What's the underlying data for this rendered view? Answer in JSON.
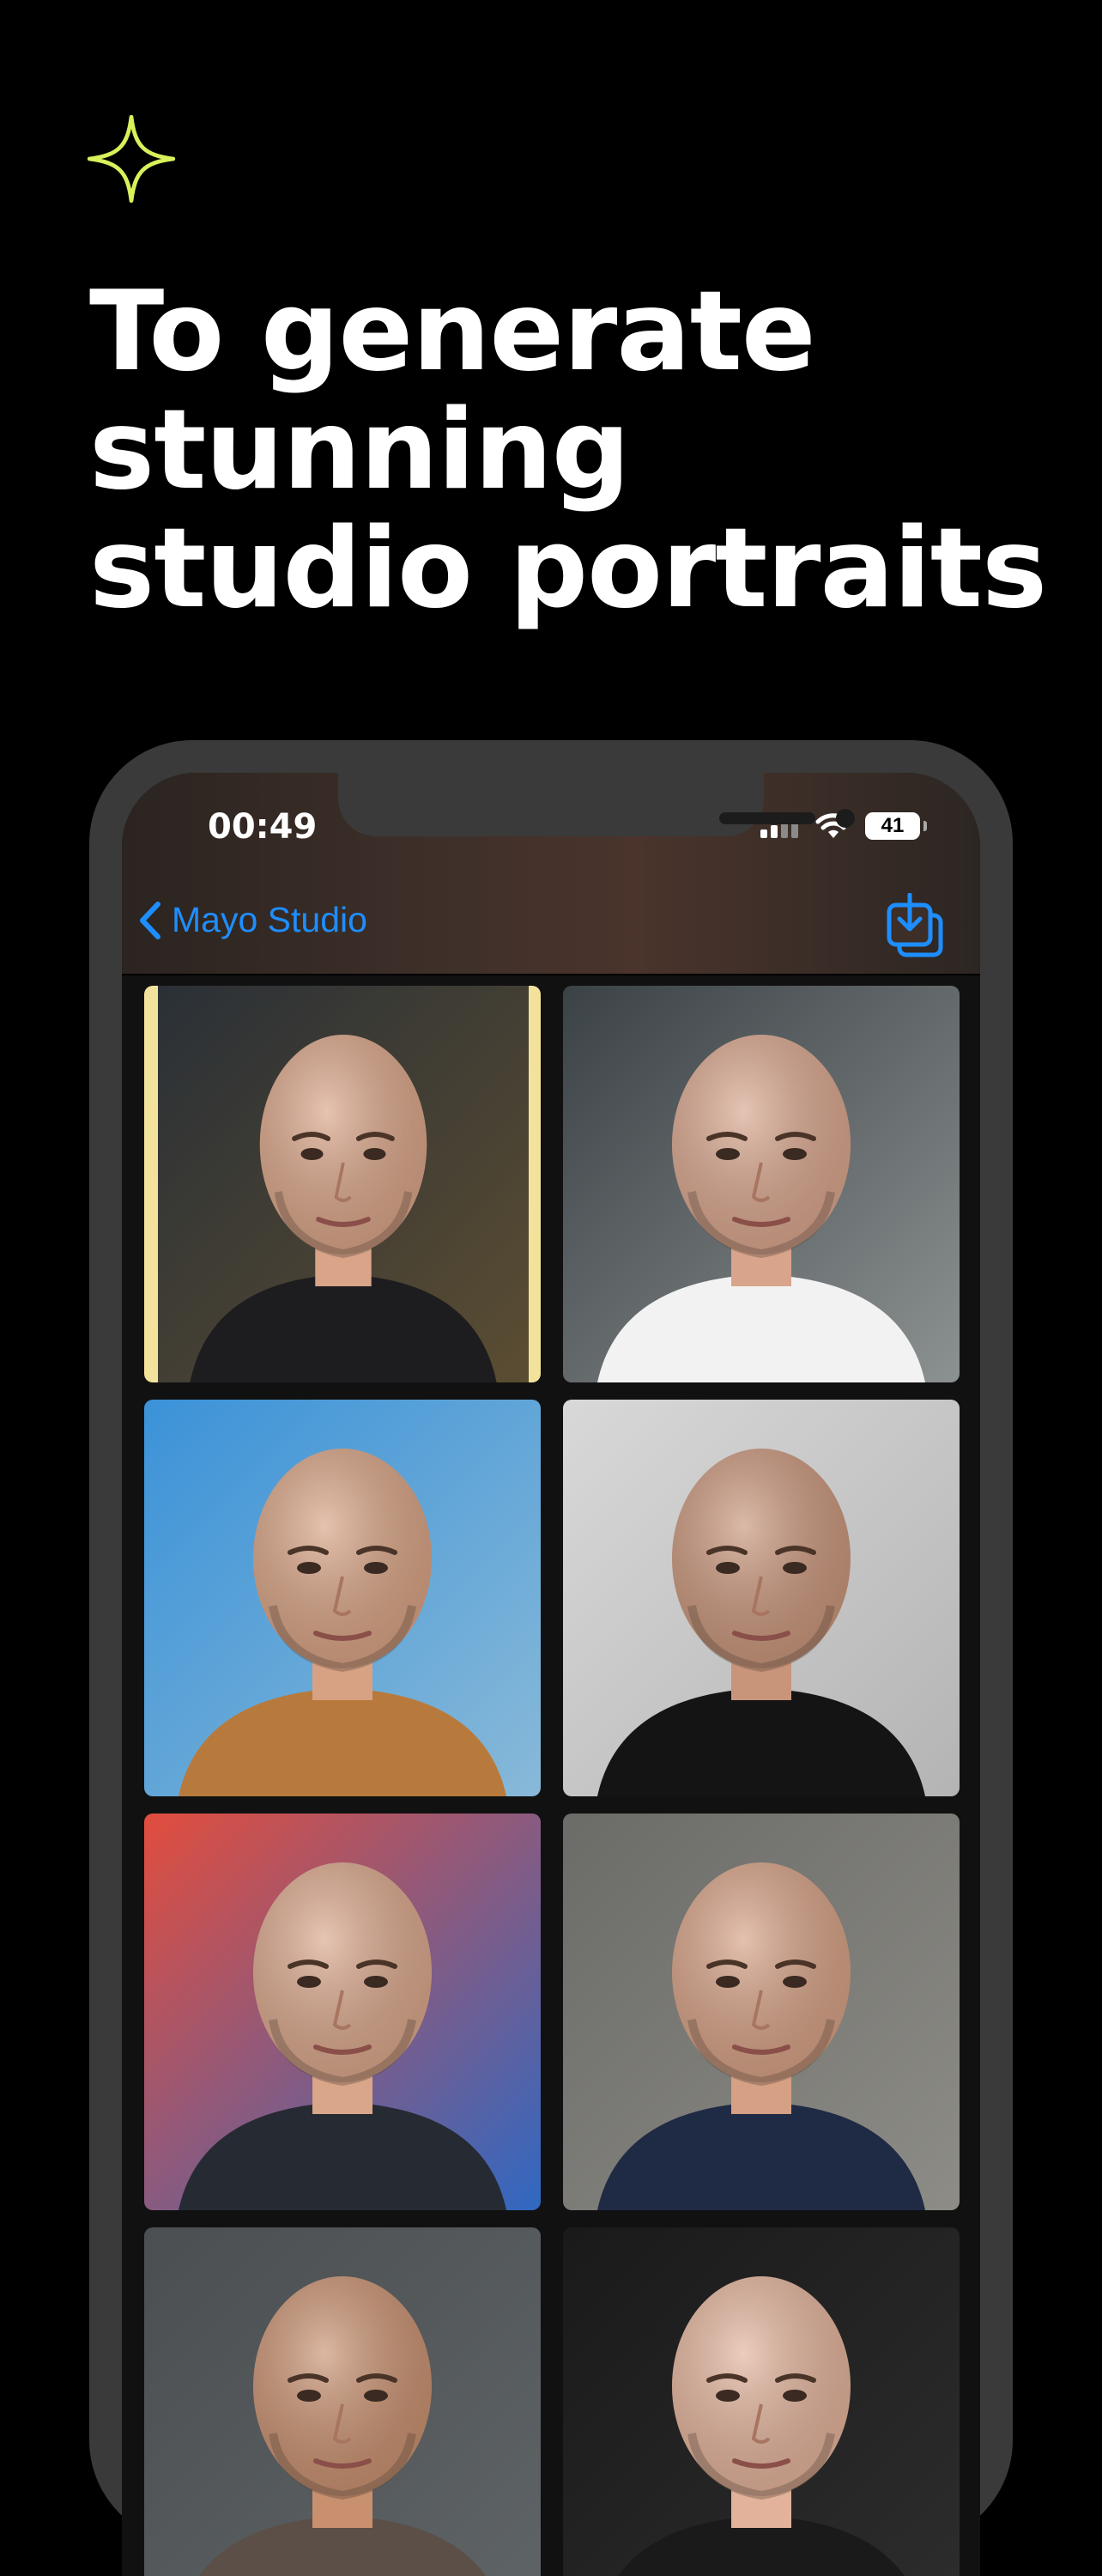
{
  "headline": {
    "lines": [
      "To generate",
      "stunning",
      "studio portraits"
    ]
  },
  "colors": {
    "accent": "#d8f05a",
    "link": "#1e8eff",
    "background": "#000000",
    "selected_frame": "#f3e29b"
  },
  "status_bar": {
    "time": "00:49",
    "battery": "41",
    "icons": [
      "cellular-signal-icon",
      "wifi-icon",
      "battery-icon"
    ]
  },
  "nav": {
    "back_label": "Mayo Studio",
    "back_icon": "chevron-left-icon",
    "action_icon": "download-icon"
  },
  "gallery": {
    "selected_index": 0,
    "photos": [
      {
        "bg": [
          "#2a3036",
          "#5b4d32"
        ],
        "clothing": "#1d1d1f",
        "skin": "#d9a487"
      },
      {
        "bg": [
          "#3b4246",
          "#8c9191"
        ],
        "clothing": "#f2f2f2",
        "skin": "#d8a58c"
      },
      {
        "bg": [
          "#3b92d8",
          "#88b9d8"
        ],
        "clothing": "#b87a3c",
        "skin": "#d7a283"
      },
      {
        "bg": [
          "#d8d8d8",
          "#b4b4b4"
        ],
        "clothing": "#141414",
        "skin": "#c8957a"
      },
      {
        "bg": [
          "#e24d3d",
          "#3068c2"
        ],
        "clothing": "#262a33",
        "skin": "#d9a68a"
      },
      {
        "bg": [
          "#6b6b68",
          "#8d8c86"
        ],
        "clothing": "#1f2a44",
        "skin": "#d5a084"
      },
      {
        "bg": [
          "#4b4f52",
          "#5f6467"
        ],
        "clothing": "#5b4f47",
        "skin": "#c8906f"
      },
      {
        "bg": [
          "#1a1a1a",
          "#2d2d2d"
        ],
        "clothing": "#1a1a1a",
        "skin": "#e2b29a"
      }
    ]
  }
}
